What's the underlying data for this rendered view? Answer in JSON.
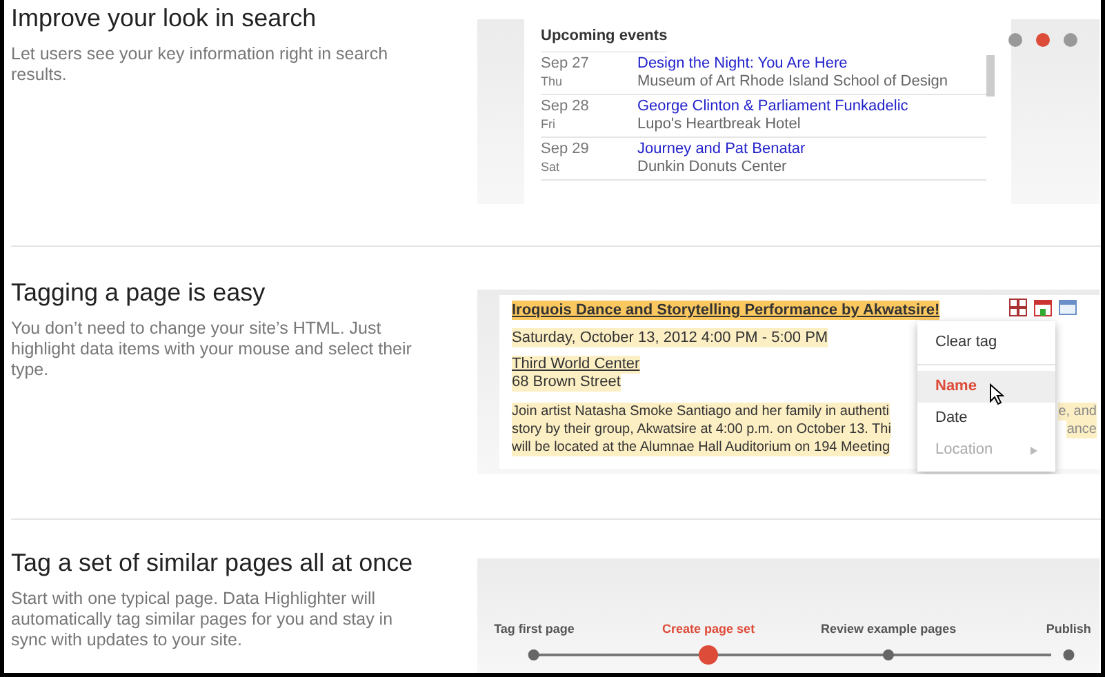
{
  "sections": [
    {
      "kind": "events",
      "title": "Improve your look in search",
      "description": "Let users see your key information right in search results.",
      "heading": "Upcoming events",
      "events": [
        {
          "date": "Sep 27",
          "day": "Thu",
          "name": "Design the Night: You Are Here",
          "venue": "Museum of Art Rhode Island School of Design"
        },
        {
          "date": "Sep 28",
          "day": "Fri",
          "name": "George Clinton & Parliament Funkadelic",
          "venue": "Lupo's Heartbreak Hotel"
        },
        {
          "date": "Sep 29",
          "day": "Sat",
          "name": "Journey and Pat Benatar",
          "venue": "Dunkin Donuts Center"
        }
      ],
      "dots": [
        {
          "selected": false
        },
        {
          "selected": true
        },
        {
          "selected": false
        }
      ]
    },
    {
      "kind": "tagging",
      "title": "Tagging a page is easy",
      "description": "You don’t need to change your site’s HTML. Just highlight data items with your mouse and select their type.",
      "event_title": "Iroquois Dance and Storytelling Performance by Akwatsire!",
      "event_date": "Saturday, October 13, 2012 4:00 PM - 5:00 PM",
      "venue": "Third World Center",
      "address": "68 Brown Street",
      "body_lines": [
        {
          "left": "Join artist Natasha Smoke Santiago and her family in authenti",
          "right": "e, and"
        },
        {
          "left": "story by their group, Akwatsire at 4:00 p.m. on October 13. Thi",
          "right": "ance"
        },
        {
          "left": "will be located at the Alumnae Hall Auditorium on 194 Meeting"
        }
      ],
      "menu": [
        {
          "label": "Clear tag",
          "selected": false,
          "disabled": false,
          "submenu": false
        },
        {
          "label": "Name",
          "selected": true,
          "disabled": false,
          "submenu": false
        },
        {
          "label": "Date",
          "selected": false,
          "disabled": false,
          "submenu": false
        },
        {
          "label": "Location",
          "selected": false,
          "disabled": true,
          "submenu": true
        }
      ]
    },
    {
      "kind": "steps",
      "title": "Tag a set of similar pages all at once",
      "description": "Start with one typical page. Data Highlighter will automatically tag similar pages for you and stay in sync with updates to your site.",
      "steps": [
        {
          "label": "Tag first page",
          "selected": false
        },
        {
          "label": "Create page set",
          "selected": true
        },
        {
          "label": "Review example pages",
          "selected": false
        },
        {
          "label": "Publish",
          "selected": false
        }
      ]
    }
  ]
}
